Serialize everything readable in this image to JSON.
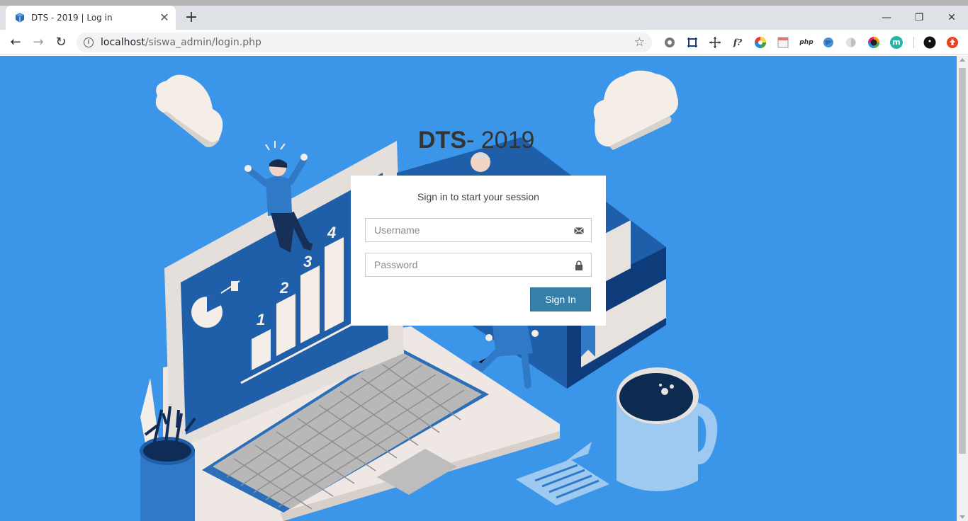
{
  "browser": {
    "tab_title": "DTS - 2019 | Log in",
    "tab_close": "✕",
    "new_tab": "+",
    "url_host": "localhost",
    "url_path": "/siswa_admin/login.php",
    "window_controls": {
      "minimize": "—",
      "restore": "❐",
      "close": "✕"
    },
    "nav": {
      "back": "←",
      "forward": "→",
      "reload": "↻"
    },
    "extensions": [
      "settings-ext",
      "crop-ext",
      "move-ext",
      "fonts-ext",
      "color-ext",
      "notes-ext",
      "php-ext",
      "globe-ext",
      "shield-ext",
      "color-picker-ext",
      "m-ext",
      "profile-ext",
      "update-ext"
    ],
    "ext_labels": {
      "fonts": "f?",
      "php": "php",
      "m": "m"
    }
  },
  "page": {
    "logo_bold": "DTS",
    "logo_rest": "- 2019",
    "login_msg": "Sign in to start your session",
    "username_placeholder": "Username",
    "password_placeholder": "Password",
    "signin_label": "Sign In",
    "chart_numbers": [
      "1",
      "2",
      "3",
      "4"
    ]
  },
  "colors": {
    "page_bg": "#3b96e9",
    "button_bg": "#367fa9"
  }
}
